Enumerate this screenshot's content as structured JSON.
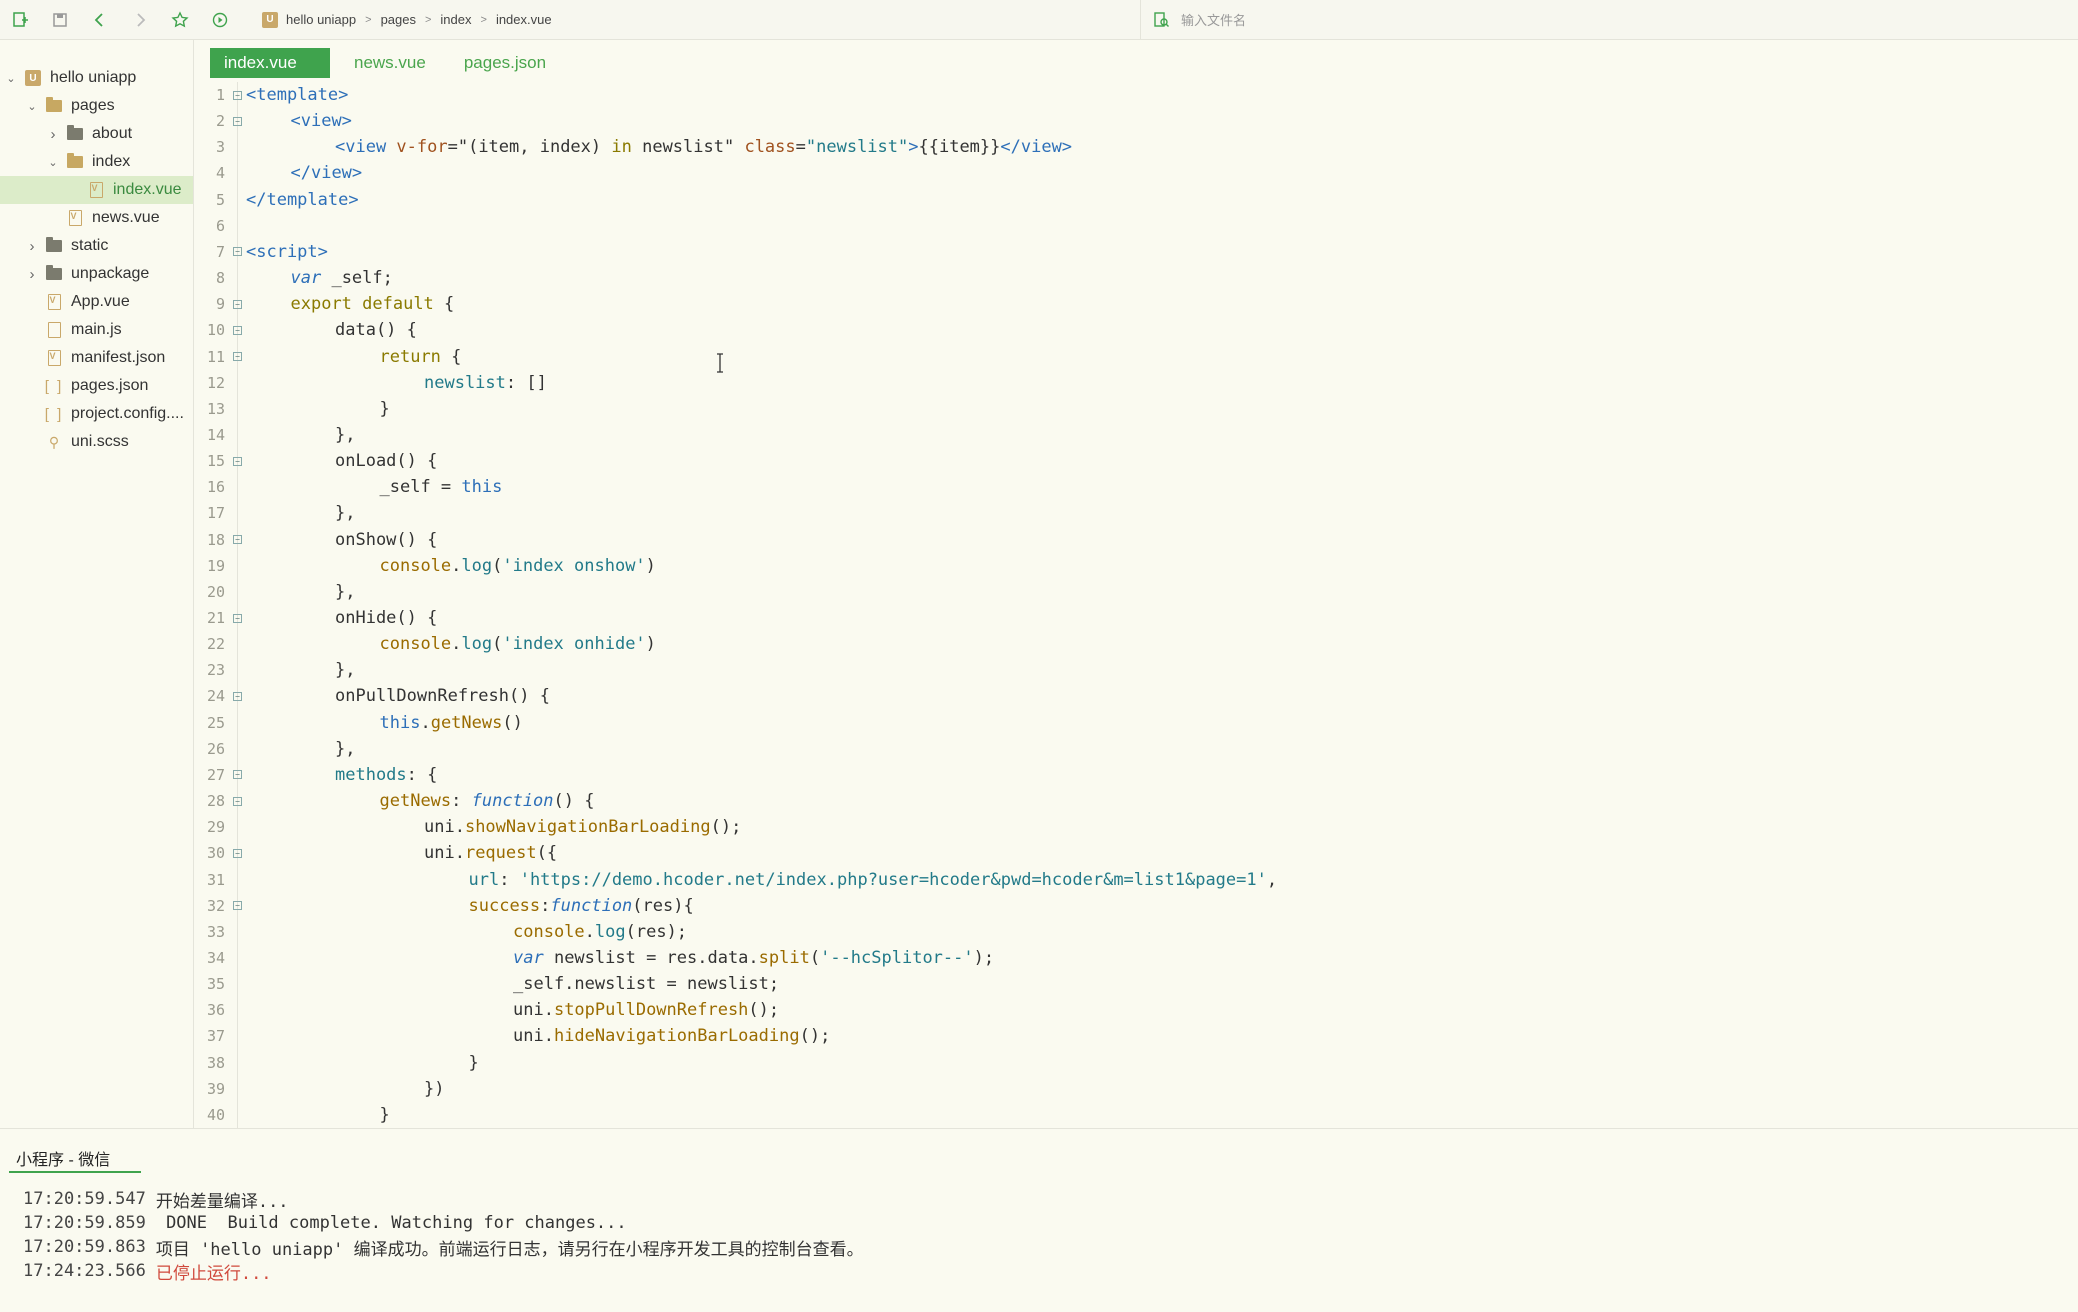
{
  "toolbar": {
    "breadcrumb": [
      "hello uniapp",
      "pages",
      "index",
      "index.vue"
    ],
    "search_placeholder": "输入文件名"
  },
  "sidebar": {
    "items": [
      {
        "label": "hello uniapp",
        "level": 0,
        "type": "project",
        "expanded": true
      },
      {
        "label": "pages",
        "level": 1,
        "type": "folder-open",
        "expanded": true
      },
      {
        "label": "about",
        "level": 2,
        "type": "folder",
        "expanded": false
      },
      {
        "label": "index",
        "level": 2,
        "type": "folder-open",
        "expanded": true
      },
      {
        "label": "index.vue",
        "level": 3,
        "type": "file",
        "selected": true
      },
      {
        "label": "news.vue",
        "level": 2,
        "type": "file"
      },
      {
        "label": "static",
        "level": 1,
        "type": "folder",
        "expanded": false
      },
      {
        "label": "unpackage",
        "level": 1,
        "type": "folder",
        "expanded": false
      },
      {
        "label": "App.vue",
        "level": 1,
        "type": "file"
      },
      {
        "label": "main.js",
        "level": 1,
        "type": "file-js"
      },
      {
        "label": "manifest.json",
        "level": 1,
        "type": "file-json"
      },
      {
        "label": "pages.json",
        "level": 1,
        "type": "bracket"
      },
      {
        "label": "project.config....",
        "level": 1,
        "type": "bracket"
      },
      {
        "label": "uni.scss",
        "level": 1,
        "type": "scss"
      }
    ]
  },
  "editor": {
    "tabs": [
      {
        "label": "index.vue",
        "active": true
      },
      {
        "label": "news.vue",
        "active": false
      },
      {
        "label": "pages.json",
        "active": false
      }
    ],
    "lines": [
      {
        "n": "1",
        "fold": true,
        "indent": 0,
        "tokens": [
          [
            "t-tag",
            "<template>"
          ]
        ]
      },
      {
        "n": "2",
        "fold": true,
        "indent": 1,
        "tokens": [
          [
            "t-tag",
            "<view>"
          ]
        ]
      },
      {
        "n": "3",
        "fold": false,
        "indent": 2,
        "tokens": [
          [
            "t-tag",
            "<view "
          ],
          [
            "t-attr",
            "v-for"
          ],
          [
            "t-punc",
            "=\"(item, index) "
          ],
          [
            "t-kw",
            "in"
          ],
          [
            "t-punc",
            " newslist\" "
          ],
          [
            "t-attr",
            "class"
          ],
          [
            "t-punc",
            "="
          ],
          [
            "t-str",
            "\"newslist\""
          ],
          [
            "t-tag",
            ">"
          ],
          [
            "t-punc",
            "{{item}}"
          ],
          [
            "t-tag",
            "</view>"
          ]
        ]
      },
      {
        "n": "4",
        "fold": false,
        "indent": 1,
        "tokens": [
          [
            "t-tag",
            "</view>"
          ]
        ]
      },
      {
        "n": "5",
        "fold": false,
        "indent": 0,
        "tokens": [
          [
            "t-tag",
            "</template>"
          ]
        ]
      },
      {
        "n": "6",
        "fold": false,
        "indent": 0,
        "tokens": []
      },
      {
        "n": "7",
        "fold": true,
        "indent": 0,
        "tokens": [
          [
            "t-tag",
            "<script>"
          ]
        ]
      },
      {
        "n": "8",
        "fold": false,
        "indent": 1,
        "tokens": [
          [
            "t-kw2",
            "var"
          ],
          [
            "t-punc",
            " _self;"
          ]
        ]
      },
      {
        "n": "9",
        "fold": true,
        "indent": 1,
        "tokens": [
          [
            "t-kw",
            "export default"
          ],
          [
            "t-punc",
            " {"
          ]
        ]
      },
      {
        "n": "10",
        "fold": true,
        "indent": 2,
        "tokens": [
          [
            "t-punc",
            "data() {"
          ]
        ]
      },
      {
        "n": "11",
        "fold": true,
        "indent": 3,
        "tokens": [
          [
            "t-kw",
            "return"
          ],
          [
            "t-punc",
            " {"
          ]
        ]
      },
      {
        "n": "12",
        "fold": false,
        "indent": 4,
        "tokens": [
          [
            "t-prop",
            "newslist"
          ],
          [
            "t-punc",
            ": []"
          ]
        ]
      },
      {
        "n": "13",
        "fold": false,
        "indent": 3,
        "tokens": [
          [
            "t-punc",
            "}"
          ]
        ]
      },
      {
        "n": "14",
        "fold": false,
        "indent": 2,
        "tokens": [
          [
            "t-punc",
            "},"
          ]
        ]
      },
      {
        "n": "15",
        "fold": true,
        "indent": 2,
        "tokens": [
          [
            "t-punc",
            "onLoad() {"
          ]
        ]
      },
      {
        "n": "16",
        "fold": false,
        "indent": 3,
        "tokens": [
          [
            "t-punc",
            "_self = "
          ],
          [
            "t-this",
            "this"
          ]
        ]
      },
      {
        "n": "17",
        "fold": false,
        "indent": 2,
        "tokens": [
          [
            "t-punc",
            "},"
          ]
        ]
      },
      {
        "n": "18",
        "fold": true,
        "indent": 2,
        "tokens": [
          [
            "t-punc",
            "onShow() {"
          ]
        ]
      },
      {
        "n": "19",
        "fold": false,
        "indent": 3,
        "tokens": [
          [
            "t-fn",
            "console"
          ],
          [
            "t-punc",
            "."
          ],
          [
            "t-prop",
            "log"
          ],
          [
            "t-punc",
            "("
          ],
          [
            "t-str",
            "'index onshow'"
          ],
          [
            "t-punc",
            ")"
          ]
        ]
      },
      {
        "n": "20",
        "fold": false,
        "indent": 2,
        "tokens": [
          [
            "t-punc",
            "},"
          ]
        ]
      },
      {
        "n": "21",
        "fold": true,
        "indent": 2,
        "tokens": [
          [
            "t-punc",
            "onHide() {"
          ]
        ]
      },
      {
        "n": "22",
        "fold": false,
        "indent": 3,
        "tokens": [
          [
            "t-fn",
            "console"
          ],
          [
            "t-punc",
            "."
          ],
          [
            "t-prop",
            "log"
          ],
          [
            "t-punc",
            "("
          ],
          [
            "t-str",
            "'index onhide'"
          ],
          [
            "t-punc",
            ")"
          ]
        ]
      },
      {
        "n": "23",
        "fold": false,
        "indent": 2,
        "tokens": [
          [
            "t-punc",
            "},"
          ]
        ]
      },
      {
        "n": "24",
        "fold": true,
        "indent": 2,
        "tokens": [
          [
            "t-punc",
            "onPullDownRefresh() {"
          ]
        ]
      },
      {
        "n": "25",
        "fold": false,
        "indent": 3,
        "tokens": [
          [
            "t-this",
            "this"
          ],
          [
            "t-punc",
            "."
          ],
          [
            "t-fn",
            "getNews"
          ],
          [
            "t-punc",
            "()"
          ]
        ]
      },
      {
        "n": "26",
        "fold": false,
        "indent": 2,
        "tokens": [
          [
            "t-punc",
            "},"
          ]
        ]
      },
      {
        "n": "27",
        "fold": true,
        "indent": 2,
        "tokens": [
          [
            "t-prop",
            "methods"
          ],
          [
            "t-punc",
            ": {"
          ]
        ]
      },
      {
        "n": "28",
        "fold": true,
        "indent": 3,
        "tokens": [
          [
            "t-fn",
            "getNews"
          ],
          [
            "t-punc",
            ": "
          ],
          [
            "t-kw2",
            "function"
          ],
          [
            "t-punc",
            "() {"
          ]
        ]
      },
      {
        "n": "29",
        "fold": false,
        "indent": 4,
        "tokens": [
          [
            "t-punc",
            "uni."
          ],
          [
            "t-fn",
            "showNavigationBarLoading"
          ],
          [
            "t-punc",
            "();"
          ]
        ]
      },
      {
        "n": "30",
        "fold": true,
        "indent": 4,
        "tokens": [
          [
            "t-punc",
            "uni."
          ],
          [
            "t-fn",
            "request"
          ],
          [
            "t-punc",
            "({"
          ]
        ]
      },
      {
        "n": "31",
        "fold": false,
        "indent": 5,
        "tokens": [
          [
            "t-prop",
            "url"
          ],
          [
            "t-punc",
            ": "
          ],
          [
            "t-str",
            "'https://demo.hcoder.net/index.php?user=hcoder&pwd=hcoder&m=list1&page=1'"
          ],
          [
            "t-punc",
            ","
          ]
        ]
      },
      {
        "n": "32",
        "fold": true,
        "indent": 5,
        "tokens": [
          [
            "t-fn",
            "success"
          ],
          [
            "t-punc",
            ":"
          ],
          [
            "t-kw2",
            "function"
          ],
          [
            "t-punc",
            "(res){"
          ]
        ]
      },
      {
        "n": "33",
        "fold": false,
        "indent": 6,
        "tokens": [
          [
            "t-fn",
            "console"
          ],
          [
            "t-punc",
            "."
          ],
          [
            "t-prop",
            "log"
          ],
          [
            "t-punc",
            "(res);"
          ]
        ]
      },
      {
        "n": "34",
        "fold": false,
        "indent": 6,
        "tokens": [
          [
            "t-kw2",
            "var"
          ],
          [
            "t-punc",
            " newslist = res.data."
          ],
          [
            "t-fn",
            "split"
          ],
          [
            "t-punc",
            "("
          ],
          [
            "t-str",
            "'--hcSplitor--'"
          ],
          [
            "t-punc",
            ");"
          ]
        ]
      },
      {
        "n": "35",
        "fold": false,
        "indent": 6,
        "tokens": [
          [
            "t-punc",
            "_self.newslist = newslist;"
          ]
        ]
      },
      {
        "n": "36",
        "fold": false,
        "indent": 6,
        "tokens": [
          [
            "t-punc",
            "uni."
          ],
          [
            "t-fn",
            "stopPullDownRefresh"
          ],
          [
            "t-punc",
            "();"
          ]
        ]
      },
      {
        "n": "37",
        "fold": false,
        "indent": 6,
        "tokens": [
          [
            "t-punc",
            "uni."
          ],
          [
            "t-fn",
            "hideNavigationBarLoading"
          ],
          [
            "t-punc",
            "();"
          ]
        ]
      },
      {
        "n": "38",
        "fold": false,
        "indent": 5,
        "tokens": [
          [
            "t-punc",
            "}"
          ]
        ]
      },
      {
        "n": "39",
        "fold": false,
        "indent": 4,
        "tokens": [
          [
            "t-punc",
            "})"
          ]
        ]
      },
      {
        "n": "40",
        "fold": false,
        "indent": 3,
        "tokens": [
          [
            "t-punc",
            "}"
          ]
        ]
      }
    ]
  },
  "console": {
    "tab_label": "小程序 - 微信",
    "logs": [
      {
        "time": "17:20:59.547",
        "msg": "开始差量编译...",
        "error": false
      },
      {
        "time": "17:20:59.859",
        "msg": " DONE  Build complete. Watching for changes...",
        "error": false
      },
      {
        "time": "17:20:59.863",
        "msg": "项目 'hello uniapp' 编译成功。前端运行日志，请另行在小程序开发工具的控制台查看。",
        "error": false
      },
      {
        "time": "17:24:23.566",
        "msg": "已停止运行...",
        "error": true
      }
    ]
  }
}
